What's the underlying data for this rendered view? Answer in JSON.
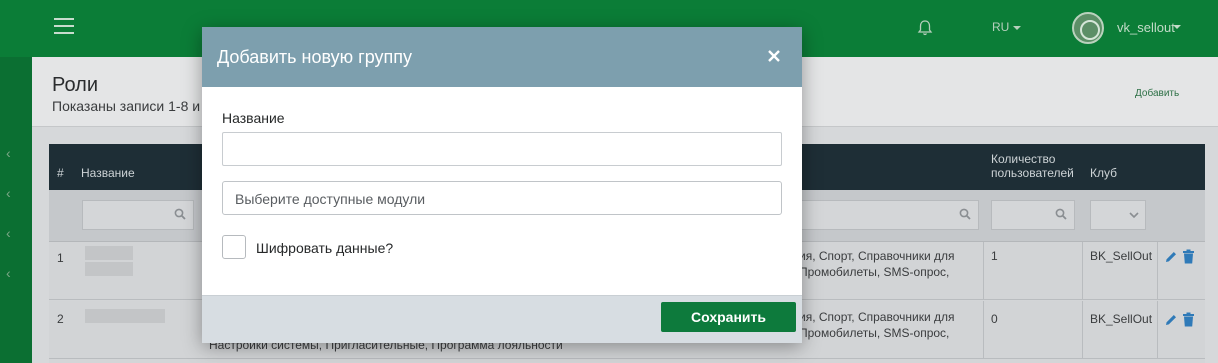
{
  "topbar": {
    "language": "RU",
    "username": "vk_sellout",
    "icons": {
      "menu": "hamburger-menu-icon",
      "notifications": "bell-icon",
      "avatar": "club-logo-avatar"
    }
  },
  "page": {
    "title": "Роли",
    "subtitle": "Показаны записи 1-8 и",
    "add_link": "Добавить",
    "table": {
      "headers": {
        "index": "#",
        "name": "Название",
        "user_count": [
          "Количество",
          "пользователей"
        ],
        "club": "Клуб"
      },
      "rows": [
        {
          "index": "1",
          "modules_line1": "ия, Спорт, Справочники для",
          "modules_line2": "Промобилеты, SMS-опрос,",
          "user_count": "1",
          "club": "BK_SellOut"
        },
        {
          "index": "2",
          "modules_line1": "ия, Спорт, Справочники для",
          "modules_line2": "Промобилеты, SMS-опрос,",
          "modules_line3": "Настройки системы, Пригласительные, Программа лояльности",
          "user_count": "0",
          "club": "BK_SellOut"
        }
      ]
    }
  },
  "modal": {
    "title": "Добавить новую группу",
    "name_label": "Название",
    "name_value": "",
    "modules_placeholder": "Выберите доступные модули",
    "encrypt_label": "Шифровать данные?",
    "encrypt_checked": false,
    "save_label": "Сохранить"
  },
  "colors": {
    "topbar": "#0b7d37",
    "modal_header": "#7d9fae",
    "save_button": "#0d7a3c",
    "table_header": "#1e2e36"
  }
}
